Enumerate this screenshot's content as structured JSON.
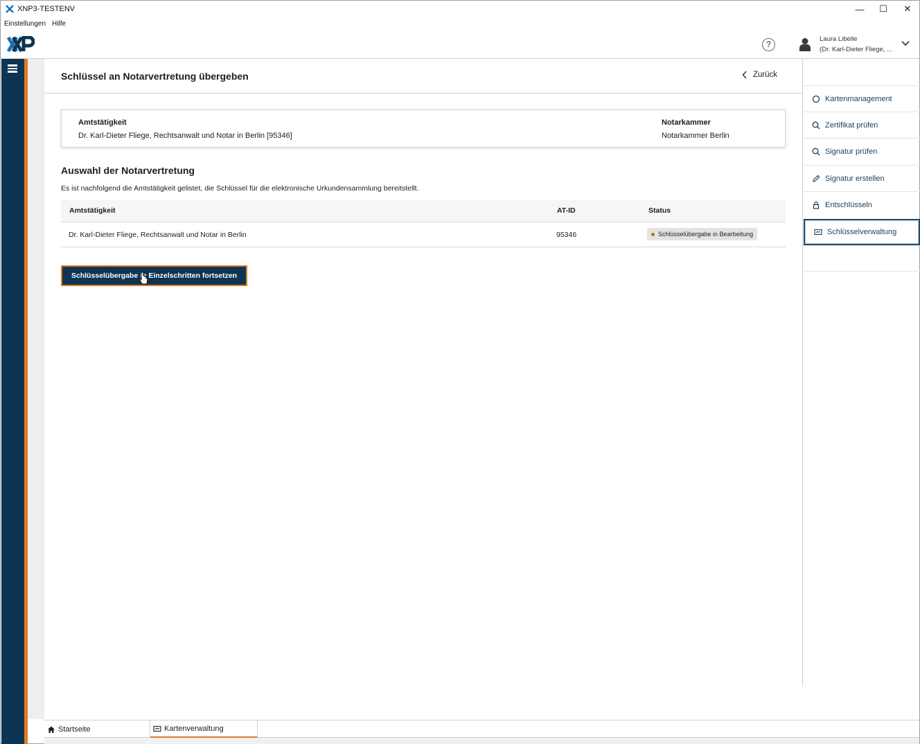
{
  "window": {
    "title": "XNP3-TESTENV",
    "minimize": "—",
    "maximize": "☐",
    "close": "✕"
  },
  "menu": {
    "items": [
      "Einstellungen",
      "Hilfe"
    ]
  },
  "header": {
    "help_symbol": "?",
    "user_name": "Laura Libelle",
    "user_sub": "(Dr. Karl-Dieter Fliege, ..."
  },
  "page": {
    "title": "Schlüssel an Notarvertretung übergeben",
    "back_label": "Zurück"
  },
  "info": {
    "left_label": "Amtstätigkeit",
    "left_value": "Dr. Karl-Dieter Fliege, Rechtsanwalt und Notar in Berlin [95346]",
    "right_label": "Notarkammer",
    "right_value": "Notarkammer Berlin"
  },
  "section": {
    "title": "Auswahl der Notarvertretung",
    "description": "Es ist nachfolgend die Amtstätigkeit gelistet, die Schlüssel für die elektronische Urkundensammlung bereitstellt."
  },
  "table": {
    "columns": [
      "Amtstätigkeit",
      "AT-ID",
      "Status"
    ],
    "rows": [
      {
        "amtstaetigkeit": "Dr. Karl-Dieter Fliege, Rechtsanwalt und Notar in Berlin",
        "at_id": "95346",
        "status": "Schlüsselübergabe in Bearbeitung"
      }
    ]
  },
  "actions": {
    "continue_label": "Schlüsselübergabe in Einzelschritten fortsetzen"
  },
  "rightpanel": {
    "items": [
      {
        "label": "Kartenmanagement",
        "icon": "circle-icon"
      },
      {
        "label": "Zertifikat prüfen",
        "icon": "search-icon"
      },
      {
        "label": "Signatur prüfen",
        "icon": "search-icon"
      },
      {
        "label": "Signatur erstellen",
        "icon": "pen-icon"
      },
      {
        "label": "Entschlüsseln",
        "icon": "lock-icon"
      },
      {
        "label": "Schlüsselverwaltung",
        "icon": "card-icon",
        "active": true
      }
    ]
  },
  "tabs": [
    {
      "label": "Startseite",
      "icon": "home-icon"
    },
    {
      "label": "Kartenverwaltung",
      "icon": "card-icon",
      "active": true
    }
  ],
  "colors": {
    "navy": "#0d3553",
    "accent": "#e07b1f",
    "status_dot": "#b07a10"
  }
}
